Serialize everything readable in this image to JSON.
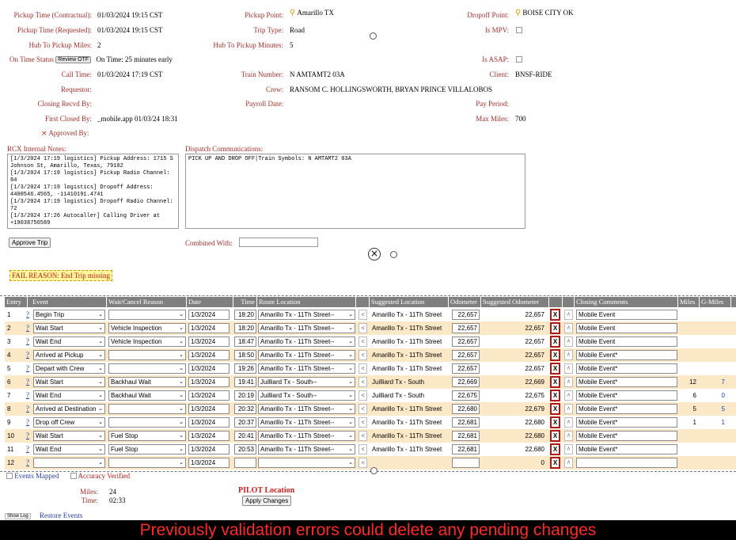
{
  "trip": {
    "pickup_time_contract": {
      "label": "Pickup Time (Contractual):",
      "value": "01/03/2024 19:15 CST"
    },
    "pickup_time_req": {
      "label": "Pickup Time (Requested):",
      "value": "01/03/2024 19:15 CST"
    },
    "hub_miles": {
      "label": "Hub To Pickup Miles:",
      "value": "2"
    },
    "on_time": {
      "label": "On Time Status",
      "btn": "Review OTF",
      "value": "On Time: 25 minutes early"
    },
    "call_time": {
      "label": "Call Time:",
      "value": "01/03/2024 17:19 CST"
    },
    "requestor": {
      "label": "Requestor:",
      "value": ""
    },
    "closing_recvd": {
      "label": "Closing Recvd By:",
      "value": ""
    },
    "first_closed": {
      "label": "First Closed By:",
      "value": "_mobile.app 01/03/24 18:31"
    },
    "approved_by": {
      "label": "Approved By:",
      "mark": "×"
    },
    "pickup_point": {
      "label": "Pickup Point:",
      "value": "Amarillo TX"
    },
    "trip_type": {
      "label": "Trip Type:",
      "value": "Road"
    },
    "hub_minutes": {
      "label": "Hub To Pickup Minutes:",
      "value": "5"
    },
    "train_number": {
      "label": "Train Number:",
      "value": "N AMTAMT2 03A"
    },
    "crew": {
      "label": "Crew:",
      "value": "RANSOM C. HOLLINGSWORTH, BRYAN PRINCE VILLALOBOS"
    },
    "payroll_date": {
      "label": "Payroll Date:",
      "value": ""
    },
    "dropoff_point": {
      "label": "Dropoff Point:",
      "value": "BOISE CITY OK"
    },
    "is_mpv": {
      "label": "Is MPV:"
    },
    "is_asap": {
      "label": "Is ASAP:"
    },
    "client": {
      "label": "Client:",
      "value": "BNSF-RIDE"
    },
    "pay_period": {
      "label": "Pay Period:",
      "value": ""
    },
    "max_miles": {
      "label": "Max Miles:",
      "value": "700"
    }
  },
  "notes": {
    "rcx_label": "RCX Internal Notes:",
    "rcx_text": "[1/3/2024 17:19 logistics] Pickup Address: 1715 S Johnson St, Amarillo, Texas, 79102\n[1/3/2024 17:19 logistics] Pickup Radio Channel: 84\n[1/3/2024 17:19 logistics] Dropoff Address: 4400546.4565, -11410191.4741\n[1/3/2024 17:19 logistics] Dropoff Radio Channel: 72\n[1/3/2024 17:26 Autocaller] Calling Driver at +19038756589",
    "dispatch_label": "Dispatch Communications:",
    "dispatch_text": "PICK UP AND DROP OFF|Train Symbols: N AMTAMT2 03A",
    "approve_btn": "Approve Trip",
    "combined_label": "Combined With:",
    "combined_value": ""
  },
  "fail_reason": "FAIL REASON: End Trip missing",
  "grid": {
    "headers": [
      "Entry",
      "Event",
      "Wait/Cancel Reason",
      "Date",
      "Time",
      "Route Location",
      "",
      "Suggested Location",
      "Odometer",
      "Suggested Odometer",
      "",
      "",
      "Closing Comments",
      "Miles",
      "G-Miles"
    ],
    "rows": [
      {
        "entry": "1",
        "q": "?",
        "event": "Begin Trip",
        "reason": "",
        "date": "1/3/2024",
        "time": "18:20",
        "route": "Amarillo Tx - 11Th Street--",
        "lt": "<",
        "sugg": "Amarillo Tx - 11Th Street",
        "odo": "22,657",
        "sodo": "22,657",
        "x": "X",
        "up": "^",
        "comment": "Mobile Event",
        "miles": "",
        "gmiles": ""
      },
      {
        "entry": "2",
        "q": "?",
        "event": "Wait Start",
        "reason": "Vehicle Inspection",
        "date": "1/3/2024",
        "time": "18:20",
        "route": "Amarillo Tx - 11Th Street--",
        "lt": "<",
        "sugg": "Amarillo Tx - 11Th Street",
        "odo": "22,657",
        "sodo": "22,657",
        "x": "X",
        "up": "^",
        "comment": "Mobile Event",
        "miles": "",
        "gmiles": ""
      },
      {
        "entry": "3",
        "q": "?",
        "event": "Wait End",
        "reason": "Vehicle Inspection",
        "date": "1/3/2024",
        "time": "18:47",
        "route": "Amarillo Tx - 11Th Street--",
        "lt": "<",
        "sugg": "Amarillo Tx - 11Th Street",
        "odo": "22,657",
        "sodo": "22,657",
        "x": "X",
        "up": "^",
        "comment": "Mobile Event",
        "miles": "",
        "gmiles": ""
      },
      {
        "entry": "4",
        "q": "?",
        "event": "Arrived at Pickup",
        "reason": "",
        "date": "1/3/2024",
        "time": "18:50",
        "route": "Amarillo Tx - 11Th Street--",
        "lt": "<",
        "sugg": "Amarillo Tx - 11Th Street",
        "odo": "22,657",
        "sodo": "22,657",
        "x": "X",
        "up": "^",
        "comment": "Mobile Event*",
        "miles": "",
        "gmiles": ""
      },
      {
        "entry": "5",
        "q": "?",
        "event": "Depart with Crew",
        "reason": "",
        "date": "1/3/2024",
        "time": "19:26",
        "route": "Amarillo Tx - 11Th Street--",
        "lt": "<",
        "sugg": "Amarillo Tx - 11Th Street",
        "odo": "22,657",
        "sodo": "22,657",
        "x": "X",
        "up": "^",
        "comment": "Mobile Event*",
        "miles": "",
        "gmiles": ""
      },
      {
        "entry": "6",
        "q": "?",
        "event": "Wait Start",
        "reason": "Backhaul Wait",
        "date": "1/3/2024",
        "time": "19:41",
        "route": "Juilliard Tx - South--",
        "lt": "<",
        "sugg": "Juilliard Tx - South",
        "odo": "22,669",
        "sodo": "22,669",
        "x": "X",
        "up": "^",
        "comment": "Mobile Event*",
        "miles": "12",
        "gmiles": "7"
      },
      {
        "entry": "7",
        "q": "?",
        "event": "Wait End",
        "reason": "Backhaul Wait",
        "date": "1/3/2024",
        "time": "20:19",
        "route": "Juilliard Tx - South--",
        "lt": "<",
        "sugg": "Juilliard Tx - South",
        "odo": "22,675",
        "sodo": "22,675",
        "x": "X",
        "up": "^",
        "comment": "Mobile Event*",
        "miles": "6",
        "gmiles": "0"
      },
      {
        "entry": "8",
        "q": "?",
        "event": "Arrived at Destination",
        "reason": "",
        "date": "1/3/2024",
        "time": "20:32",
        "route": "Amarillo Tx - 11Th Street--",
        "lt": "<",
        "sugg": "Amarillo Tx - 11Th Street",
        "odo": "22,680",
        "sodo": "22,679",
        "x": "X",
        "up": "^",
        "comment": "Mobile Event*",
        "miles": "5",
        "gmiles": "5"
      },
      {
        "entry": "9",
        "q": "?",
        "event": "Drop off Crew",
        "reason": "",
        "date": "1/3/2024",
        "time": "20:37",
        "route": "Amarillo Tx - 11Th Street--",
        "lt": "<",
        "sugg": "Amarillo Tx - 11Th Street",
        "odo": "22,681",
        "sodo": "22,680",
        "x": "X",
        "up": "^",
        "comment": "Mobile Event*",
        "miles": "1",
        "gmiles": "1"
      },
      {
        "entry": "10",
        "q": "?",
        "event": "Wait Start",
        "reason": "Fuel Stop",
        "date": "1/3/2024",
        "time": "20:41",
        "route": "Amarillo Tx - 11Th Street--",
        "lt": "<",
        "sugg": "Amarillo Tx - 11Th Street",
        "odo": "22,681",
        "sodo": "22,680",
        "x": "X",
        "up": "^",
        "comment": "Mobile Event*",
        "miles": "",
        "gmiles": ""
      },
      {
        "entry": "11",
        "q": "?",
        "event": "Wait End",
        "reason": "Fuel Stop",
        "date": "1/3/2024",
        "time": "20:53",
        "route": "Amarillo Tx - 11Th Street--",
        "lt": "<",
        "sugg": "Amarillo Tx - 11Th Street",
        "odo": "22,681",
        "sodo": "22,680",
        "x": "X",
        "up": "^",
        "comment": "Mobile Event*",
        "miles": "",
        "gmiles": ""
      },
      {
        "entry": "12",
        "q": "?",
        "event": "",
        "reason": "",
        "date": "1/3/2024",
        "time": "",
        "route": "",
        "lt": "<",
        "sugg": "",
        "odo": "",
        "sodo": "0",
        "x": "X",
        "up": "^",
        "comment": "",
        "miles": "",
        "gmiles": ""
      }
    ]
  },
  "footer": {
    "events_mapped": "Events Mapped",
    "accuracy_verified": "Accuracy Verified",
    "miles_label": "Miles:",
    "miles_value": "24",
    "time_label": "Time:",
    "time_value": "02:33",
    "pilot_location": "PILOT Location",
    "apply_btn": "Apply Changes",
    "show_log": "Show Log",
    "restore_events": "Restore Events"
  },
  "banner": "Previously validation errors could delete any pending changes",
  "colors": {
    "label": "#a0302c",
    "header_bg": "#7f7f7f",
    "alt_row": "#fbe8c6",
    "x_border": "#b01818",
    "banner_text": "#ff2a2a",
    "fail_bg": "#fff59a"
  }
}
